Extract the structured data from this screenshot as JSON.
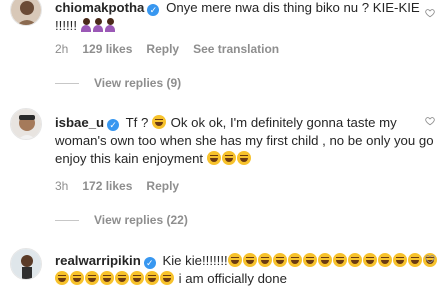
{
  "comments": [
    {
      "username": "chiomakpotha",
      "text_line1": "Onye mere nwa dis thing biko nu ? KIE-KIE",
      "text_line2": "!!!!!!",
      "emoji_count": 3,
      "time": "2h",
      "likes": "129 likes",
      "reply": "Reply",
      "translation": "See translation",
      "view_replies": "View replies (9)"
    },
    {
      "username": "isbae_u",
      "text_lead": "Tf ?",
      "text_main": "Ok ok ok, I'm definitely gonna taste my woman's own too when she has my first child , no be only you go enjoy this kain enjoyment",
      "time": "3h",
      "likes": "172 likes",
      "reply": "Reply",
      "view_replies": "View replies (22)"
    },
    {
      "username": "realwarripikin",
      "text_lead": "Kie kie!!!!!!!",
      "text_tail_1": "i",
      "text_tail_2": "am officially done"
    }
  ],
  "colors": {
    "verified": "#3897f0",
    "muted": "#8e8e8e",
    "text": "#262626"
  }
}
